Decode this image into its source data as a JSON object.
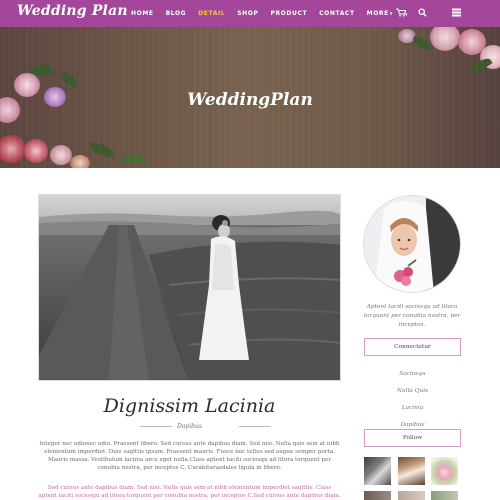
{
  "nav": {
    "logo": "Wedding Plan",
    "items": [
      {
        "label": "HOME"
      },
      {
        "label": "BLOG"
      },
      {
        "label": "DETAIL"
      },
      {
        "label": "SHOP"
      },
      {
        "label": "PRODUCT"
      },
      {
        "label": "CONTACT"
      },
      {
        "label": "MORE"
      }
    ],
    "active_item": "DETAIL",
    "icons": [
      "cart-icon",
      "search-icon",
      "menu-icon"
    ]
  },
  "hero": {
    "title": "WeddingPlan"
  },
  "post": {
    "title": "Dignissim Lacinia",
    "subtitle": "Dapibus",
    "body": "Integer nec odionec odio. Praesent libero. Sed cursus ante dapibus diam. Sed nisi. Nulla quis sem at nibh elementum imperdiet. Duis sagittis ipsum. Praesent mauris. Fusce nec tellus sed augue semper porta. Mauris massa. Vestibulum lacinia arcu eget nulla.Class aptent taciti sociosqu ad litora torquent per conubia nostra, per inceptos C. Curabiturasdales ligula in libero.",
    "body2": "Sed cursus ante dapibus diam. Sed nisi. Nulla quis sem at nibh elementum imperdiet sagittis. Class aptent taciti sociosqu ad litora torquent per conubia nostra, per inceptos C.Sed cursus ante dapibus diam. Sed nisi. Nulla quis sem at"
  },
  "sidebar": {
    "about": "Aptent taciti sociosqu ad litora torquent per conubia nostra, per inceptos.",
    "connect_label": "Connectetur",
    "links": [
      "Sociosqu",
      "Nulla Quis",
      "Lacinia",
      "Dapibus"
    ],
    "follow_label": "Follow"
  },
  "colors": {
    "nav_bg": "#a4479a",
    "active": "#f3c53a",
    "accent_border": "#d89acb",
    "link_pink": "#c26aa6"
  }
}
